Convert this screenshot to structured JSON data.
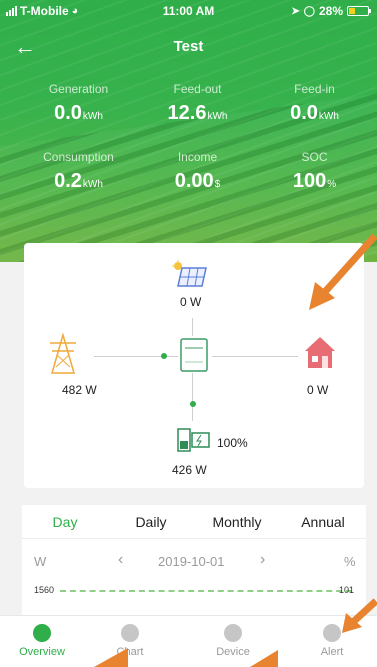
{
  "status_bar": {
    "carrier": "T-Mobile",
    "time": "11:00 AM",
    "battery": "28%"
  },
  "header": {
    "title": "Test"
  },
  "stats": [
    {
      "label": "Generation",
      "value": "0.0",
      "unit": "kWh"
    },
    {
      "label": "Feed-out",
      "value": "12.6",
      "unit": "kWh"
    },
    {
      "label": "Feed-in",
      "value": "0.0",
      "unit": "kWh"
    },
    {
      "label": "Consumption",
      "value": "0.2",
      "unit": "kWh"
    },
    {
      "label": "Income",
      "value": "0.00",
      "unit": "$"
    },
    {
      "label": "SOC",
      "value": "100",
      "unit": "%"
    }
  ],
  "flow": {
    "solar_power": "0 W",
    "grid_power": "482 W",
    "home_power": "0 W",
    "battery_power": "426 W",
    "battery_soc": "100%"
  },
  "tabs": [
    "Day",
    "Daily",
    "Monthly",
    "Annual"
  ],
  "date_nav": {
    "left_unit": "W",
    "date": "2019-10-01",
    "right_unit": "%"
  },
  "chart_axes": {
    "left_max": "1560",
    "right_max": "101"
  },
  "bottom_nav": [
    {
      "label": "Overview"
    },
    {
      "label": "Chart"
    },
    {
      "label": "Device"
    },
    {
      "label": "Alert"
    }
  ],
  "colors": {
    "brand_green": "#2fae49",
    "annotation_orange": "#e8832f"
  }
}
